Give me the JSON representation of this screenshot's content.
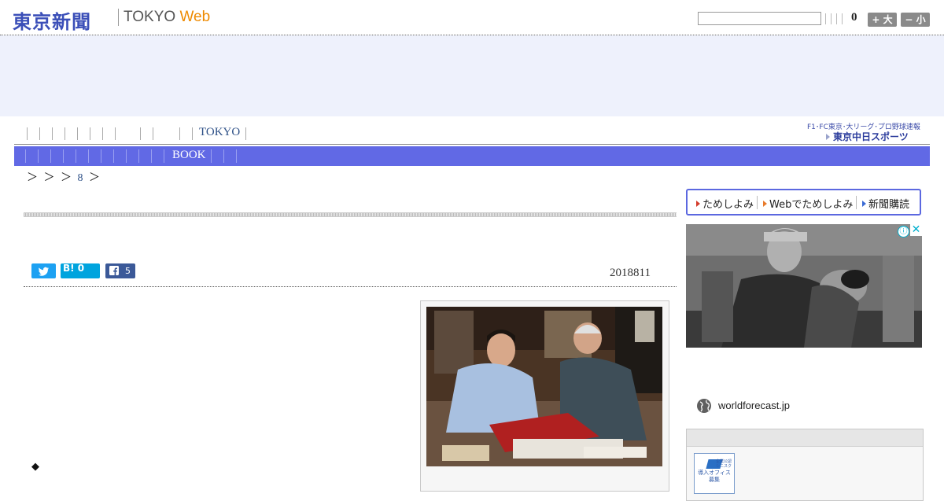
{
  "header": {
    "logo_jp": "東京新聞",
    "logo_en_main": "TOKYO ",
    "logo_en_web": "Web",
    "font_count": "0",
    "plus_label": "+ 大",
    "minus_label": "− 小"
  },
  "nav": {
    "tokyo_label": "TOKYO",
    "sports_top": "F1･FC東京･大リーグ･プロ野球速報",
    "sports_logo": "東京中日スポーツ"
  },
  "subnav": {
    "book_label": "BOOK"
  },
  "breadcrumb": {
    "prefix": "＞ ＞ ＞",
    "page_num": "8",
    "suffix": "＞"
  },
  "article": {
    "date": "2018811",
    "hatena_label": "B! 0",
    "facebook_count": "5",
    "bullet": "◆"
  },
  "promo": {
    "item1": "ためしよみ",
    "item2": "Webでためしよみ",
    "item3": "新聞購読"
  },
  "ad": {
    "domain": "worldforecast.jp",
    "info_glyph": "ⓘ",
    "close_glyph": "✕"
  },
  "side_banner": {
    "line1": "導入オフィス",
    "line2": "募集",
    "small": "企業公認 シニスク"
  },
  "colors": {
    "brand_blue": "#3b4fb8",
    "web_orange": "#ee8a00",
    "subnav_bg": "#6169e5",
    "ad_band_bg": "#eef1fc",
    "twitter": "#1da1f2",
    "hatena": "#00a4de",
    "facebook": "#3b5998",
    "promo_border": "#5c68e0"
  }
}
